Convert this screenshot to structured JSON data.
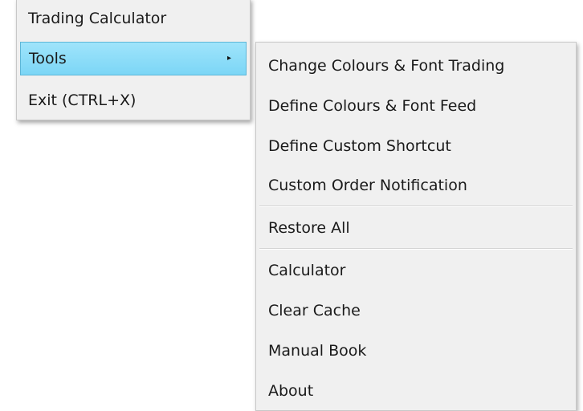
{
  "main_menu": {
    "items": [
      {
        "label": "Trading Calculator"
      },
      {
        "label": "Tools",
        "arrow": "▸"
      },
      {
        "label": "Exit (CTRL+X)"
      }
    ]
  },
  "tools_submenu": {
    "items": [
      {
        "label": "Change Colours & Font Trading"
      },
      {
        "label": "Define Colours & Font Feed"
      },
      {
        "label": "Define Custom Shortcut"
      },
      {
        "label": "Custom Order Notification"
      },
      {
        "label": "Restore All"
      },
      {
        "label": "Calculator"
      },
      {
        "label": "Clear Cache"
      },
      {
        "label": "Manual Book"
      },
      {
        "label": "About"
      }
    ]
  },
  "colors": {
    "menu_background": "#f0f0f0",
    "highlight": "#7cd6f6",
    "highlight_border": "#5cb6d8"
  }
}
